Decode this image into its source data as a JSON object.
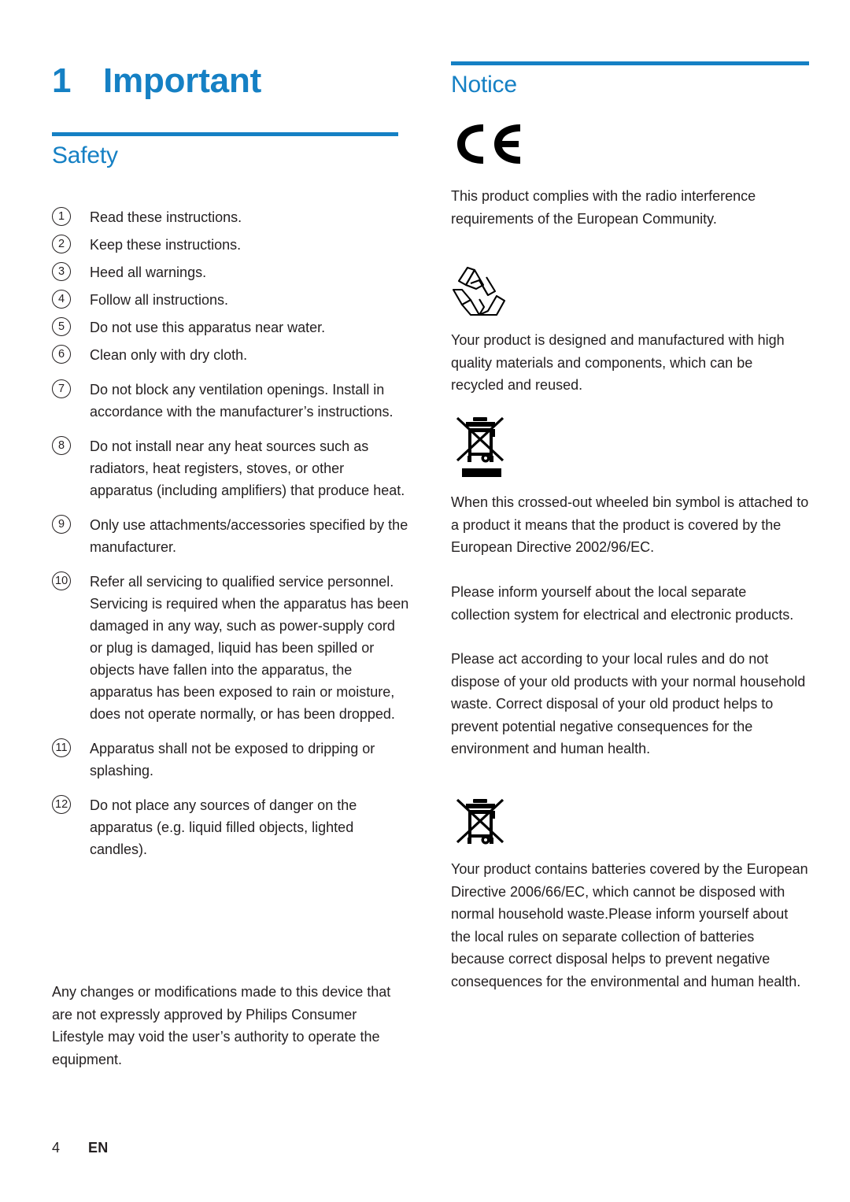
{
  "chapter": {
    "number": "1",
    "title": "Important"
  },
  "safety": {
    "heading": "Safety",
    "items": [
      {
        "num": "1",
        "text": "Read these instructions."
      },
      {
        "num": "2",
        "text": "Keep these instructions."
      },
      {
        "num": "3",
        "text": "Heed all warnings."
      },
      {
        "num": "4",
        "text": "Follow all instructions."
      },
      {
        "num": "5",
        "text": "Do not use this apparatus near water."
      },
      {
        "num": "6",
        "text": "Clean only with dry cloth."
      },
      {
        "num": "7",
        "text": "Do not block any ventilation openings. Install in accordance with the manufacturer’s instructions."
      },
      {
        "num": "8",
        "text": "Do not install near any heat sources such as radiators, heat registers, stoves, or other apparatus (including amplifiers) that produce heat."
      },
      {
        "num": "9",
        "text": "Only use attachments/accessories specified by the manufacturer."
      },
      {
        "num": "10",
        "text": "Refer all servicing to qualified service personnel. Servicing is required when the apparatus has been damaged in any way, such as power-supply cord or plug is damaged, liquid has been spilled or objects have fallen into the apparatus, the apparatus has been exposed to rain or moisture, does not operate normally, or has been dropped."
      },
      {
        "num": "11",
        "text": "Apparatus shall not be exposed to dripping or splashing."
      },
      {
        "num": "12",
        "text": "Do not place any sources of danger on the apparatus (e.g. liquid filled objects, lighted candles)."
      }
    ],
    "closing_paragraph": "Any changes or modifications made to this device that are not expressly approved by Philips Consumer Lifestyle may void the user’s authority to operate the equipment."
  },
  "notice": {
    "heading": "Notice",
    "ce_mark_label": "CE",
    "ce_paragraph": "This product complies with the radio interference requirements of the European Community.",
    "recycle_paragraph": "Your product is designed and manufactured with high quality materials and components, which can be recycled and reused.",
    "weee_paragraph_1": "When this crossed-out wheeled bin symbol is attached to a product it means that the product is covered by the European Directive 2002/96/EC.",
    "weee_paragraph_2": "Please inform yourself about the local separate collection system for electrical and electronic products.",
    "weee_paragraph_3": "Please act according to your local rules and do not dispose of your old products with your normal household waste. Correct disposal of your old product helps to prevent potential negative consequences for the environment and human health.",
    "battery_paragraph": "Your product contains batteries covered by the European Directive 2006/66/EC, which cannot be disposed with normal household waste.Please inform yourself about the local rules on separate collection of batteries because correct disposal helps to prevent negative consequences for the environmental and human health."
  },
  "footer": {
    "page_number": "4",
    "language": "EN"
  },
  "colors": {
    "accent_blue": "#1580c4",
    "body_text": "#231f20"
  }
}
